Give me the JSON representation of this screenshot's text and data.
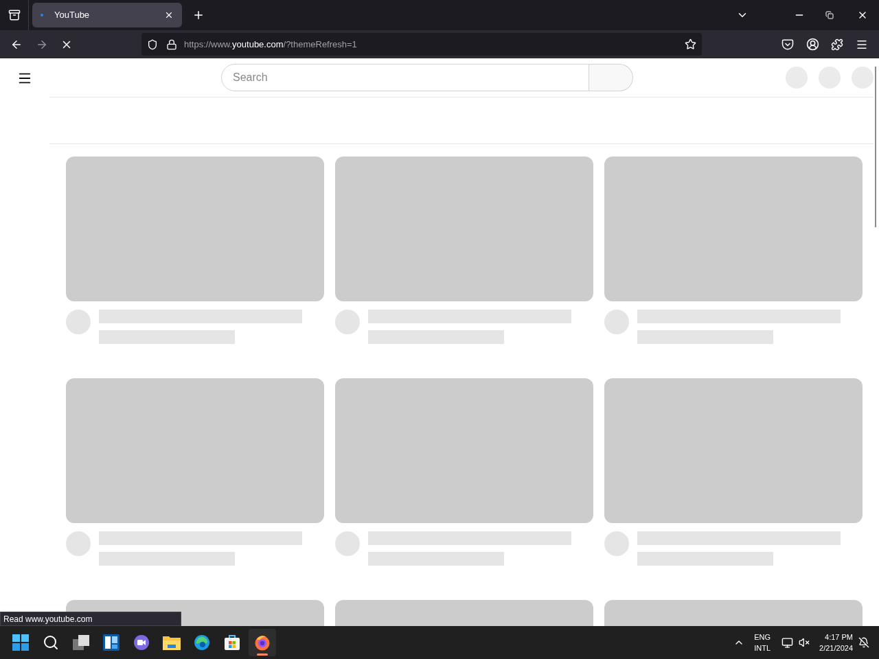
{
  "browser": {
    "tabs": [
      {
        "title": "YouTube",
        "selected": true
      }
    ],
    "address": {
      "prefix": "https://www.",
      "domain": "youtube.com",
      "suffix": "/?themeRefresh=1"
    },
    "loading": true
  },
  "page": {
    "search": {
      "placeholder": "Search"
    }
  },
  "status_text": "Read www.youtube.com",
  "taskbar": {
    "apps": [
      {
        "kind": "start",
        "selected": false
      },
      {
        "kind": "search",
        "selected": false
      },
      {
        "kind": "taskview",
        "selected": false
      },
      {
        "kind": "widgets",
        "selected": false
      },
      {
        "kind": "chat",
        "selected": false
      },
      {
        "kind": "files",
        "selected": false
      },
      {
        "kind": "edge",
        "selected": false
      },
      {
        "kind": "store",
        "selected": false
      },
      {
        "kind": "firefox",
        "selected": true
      }
    ],
    "language": [
      "ENG",
      "INTL"
    ],
    "time": "4:17 PM",
    "date": "2/21/2024"
  }
}
